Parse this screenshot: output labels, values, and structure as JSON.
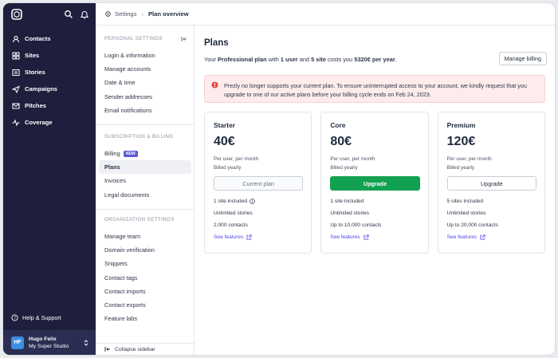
{
  "nav": {
    "items": [
      {
        "label": "Contacts",
        "icon": "contacts-icon"
      },
      {
        "label": "Sites",
        "icon": "sites-icon"
      },
      {
        "label": "Stories",
        "icon": "stories-icon"
      },
      {
        "label": "Campaigns",
        "icon": "campaigns-icon"
      },
      {
        "label": "Pitches",
        "icon": "pitches-icon"
      },
      {
        "label": "Coverage",
        "icon": "coverage-icon"
      }
    ],
    "help_label": "Help & Support",
    "user": {
      "initials": "HF",
      "name": "Hugo Felix",
      "studio": "My Super Studio"
    }
  },
  "breadcrumb": {
    "parent": "Settings",
    "current": "Plan overview"
  },
  "settings": {
    "sections": [
      {
        "title": "PERSONAL SETTINGS",
        "items": [
          "Login & information",
          "Manage accounts",
          "Date & time",
          "Sender addresses",
          "Email notifications"
        ]
      },
      {
        "title": "SUBSCRIPTION & BILLING",
        "items": [
          "Billing",
          "Plans",
          "Invoices",
          "Legal documents"
        ],
        "badge": "NEW"
      },
      {
        "title": "ORGANIZATION SETTINGS",
        "items": [
          "Manage team",
          "Domain verification",
          "Snippets",
          "Contact tags",
          "Contact imports",
          "Contact exports",
          "Feature labs"
        ]
      }
    ],
    "collapse_label": "Collapse sidebar"
  },
  "main": {
    "title": "Plans",
    "summary": {
      "p1": "Your ",
      "plan": "Professional plan",
      "p2": " with ",
      "users": "1 user",
      "p3": " and ",
      "sites": "5 site",
      "p4": " costs you ",
      "cost": "5320€ per year",
      "p5": "."
    },
    "manage_billing": "Manage billing",
    "alert": "Prezly no longer supports your current plan. To ensure uninterrupted access to your account, we kindly request that you upgrade to one of our active plans before your billing cycle ends on Feb 24, 2023.",
    "plans": [
      {
        "name": "Starter",
        "price": "40€",
        "per": "Per user, per month",
        "billed": "Billed yearly",
        "button": "Current plan",
        "features": [
          "1 site included",
          "Unlimited stories",
          "2,000 contacts"
        ],
        "see": "See features"
      },
      {
        "name": "Core",
        "price": "80€",
        "per": "Per user, per month",
        "billed": "Billed yearly",
        "button": "Upgrade",
        "features": [
          "1 site included",
          "Unlimited stories",
          "Up to 10,000 contacts"
        ],
        "see": "See features"
      },
      {
        "name": "Premium",
        "price": "120€",
        "per": "Per user, per month",
        "billed": "Billed yearly",
        "button": "Upgrade",
        "features": [
          "5 sites included",
          "Unlimited stories",
          "Up to 20,000 contacts"
        ],
        "see": "See features"
      }
    ]
  },
  "colors": {
    "sidebar": "#1d1f3d",
    "accent_green": "#12a150",
    "link": "#4f46e5",
    "alert_bg": "#fdeceb",
    "alert_icon": "#e5484d"
  }
}
